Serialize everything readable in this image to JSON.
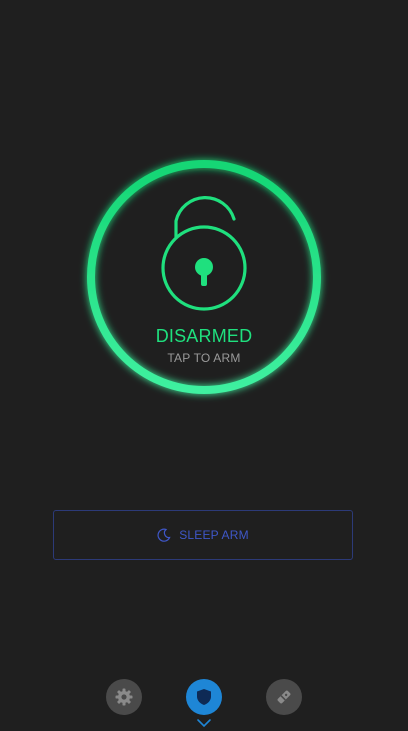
{
  "status": {
    "label": "DISARMED",
    "hint": "TAP TO ARM"
  },
  "sleep_arm": {
    "label": "SLEEP ARM",
    "icon": "moon-icon"
  },
  "nav": {
    "items": [
      {
        "icon": "gear-icon"
      },
      {
        "icon": "shield-icon",
        "active": true
      },
      {
        "icon": "sensor-icon"
      }
    ]
  },
  "colors": {
    "background": "#1f1f1f",
    "accent_green": "#1fe07e",
    "sleep_blue": "#3f57c8",
    "nav_active": "#1e86d6",
    "nav_inactive": "#4a4a4a"
  }
}
